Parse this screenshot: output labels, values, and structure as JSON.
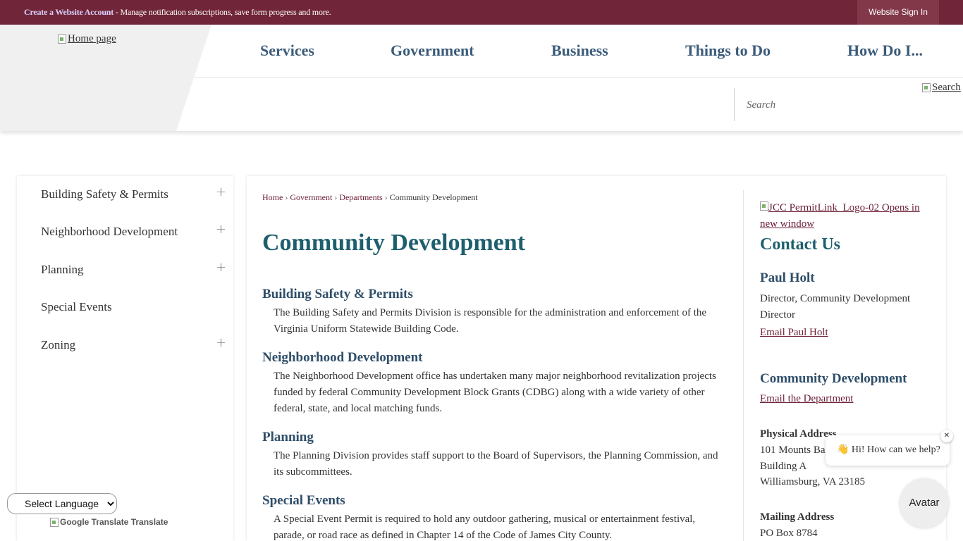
{
  "topbar": {
    "create_account_link": "Create a Website Account",
    "create_account_text": " - Manage notification subscriptions, save form progress and more.",
    "sign_in": "Website Sign In"
  },
  "header": {
    "home_alt": "Home page",
    "nav": [
      "Services",
      "Government",
      "Business",
      "Things to Do",
      "How Do I..."
    ],
    "search_placeholder": "Search",
    "search_button": "Search"
  },
  "sidebar": {
    "items": [
      {
        "label": "Building Safety & Permits",
        "expandable": true
      },
      {
        "label": "Neighborhood Development",
        "expandable": true
      },
      {
        "label": "Planning",
        "expandable": true
      },
      {
        "label": "Special Events",
        "expandable": false
      },
      {
        "label": "Zoning",
        "expandable": true
      }
    ],
    "expand_glyph": "+"
  },
  "breadcrumb": {
    "items": [
      "Home",
      "Government",
      "Departments"
    ],
    "current": "Community Development",
    "separator": "›"
  },
  "main": {
    "title": "Community Development",
    "sections": [
      {
        "heading": "Building Safety & Permits",
        "body": "The Building Safety and Permits Division is responsible for the administration and enforcement of the Virginia Uniform Statewide Building Code."
      },
      {
        "heading": "Neighborhood Development",
        "body": "The Neighborhood Development office has undertaken many major neighborhood revitalization projects funded by federal Community Development Block Grants (CDBG) along with a wide variety of other federal, state, and local matching funds."
      },
      {
        "heading": "Planning",
        "body": "The Planning Division provides staff support to the Board of Supervisors, the Planning Commission, and its subcommittees."
      },
      {
        "heading": "Special Events",
        "body": "A Special Event Permit is required to hold any outdoor gathering, musical or entertainment festival, parade, or road race as defined in Chapter 14 of the Code of James City County."
      }
    ]
  },
  "aside": {
    "permit_link": "JCC PermitLink_Logo-02 Opens in new window",
    "contact_title": "Contact Us",
    "person_name": "Paul Holt",
    "person_title": "Director, Community Development Director",
    "email_person": "Email Paul Holt",
    "dept_title": "Community Development",
    "email_dept": "Email the Department",
    "physical_label": "Physical Address",
    "physical_lines": [
      "101 Mounts Ba",
      "Building A",
      "Williamsburg, VA 23185"
    ],
    "mailing_label": "Mailing Address",
    "mailing_lines": [
      "PO Box 8784"
    ]
  },
  "chat": {
    "greeting": "👋 Hi! How can we help?",
    "close": "✕",
    "avatar": "Avatar"
  },
  "translate": {
    "select_label": "Select Language",
    "google_text": "Google Translate Translate"
  }
}
